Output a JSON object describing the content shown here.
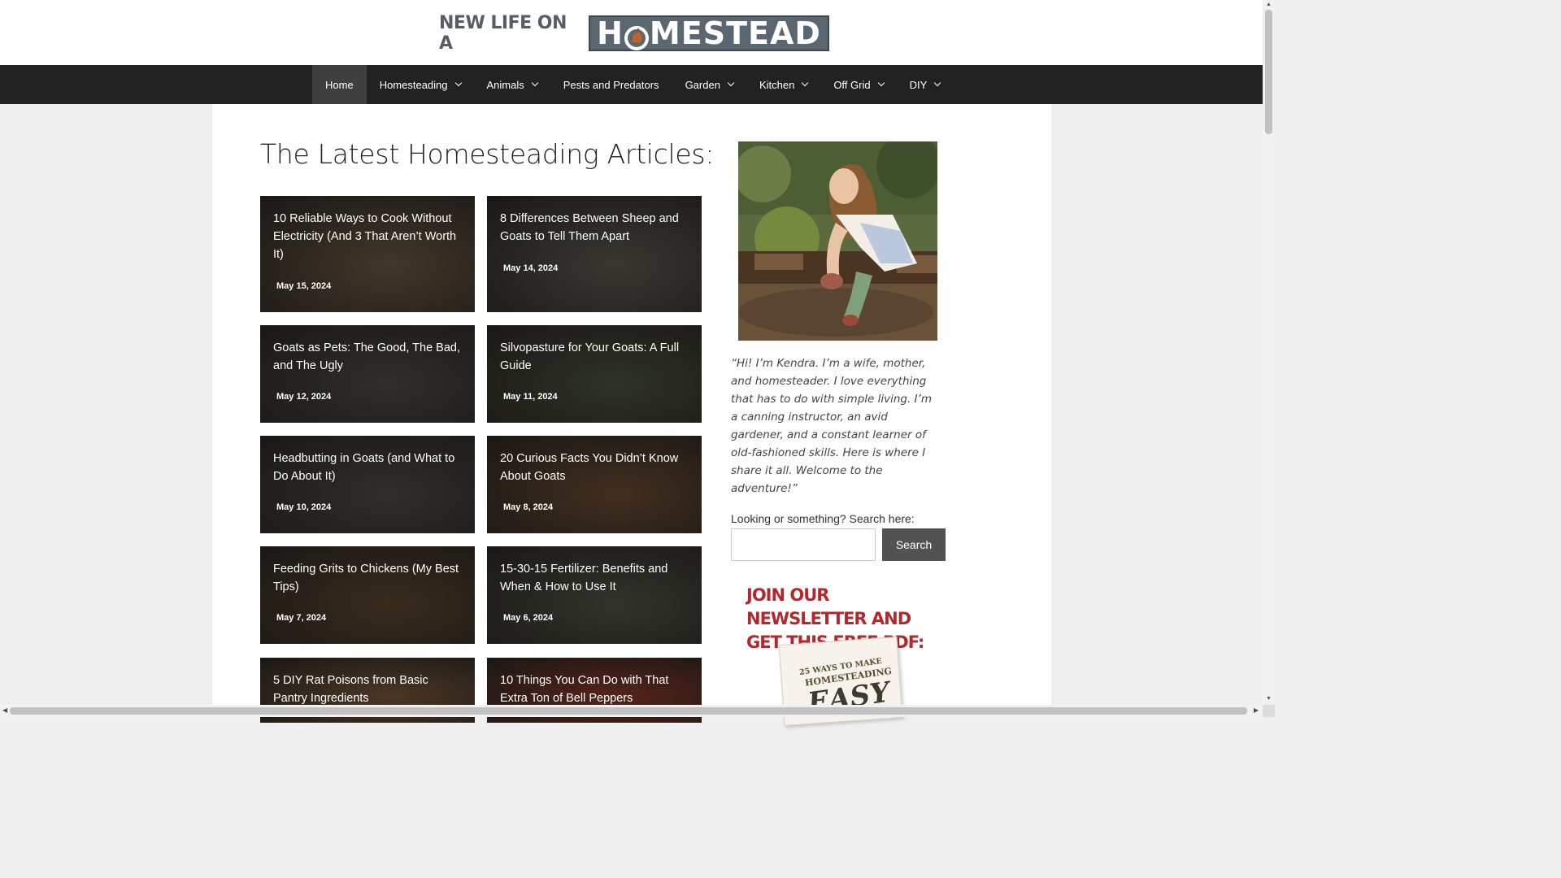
{
  "logo": {
    "prefix": "NEW LIFE ON A",
    "word_start": "H",
    "word_end": "MESTEAD"
  },
  "nav": {
    "items": [
      {
        "label": "Home",
        "active": true,
        "dropdown": false
      },
      {
        "label": "Homesteading",
        "active": false,
        "dropdown": true
      },
      {
        "label": "Animals",
        "active": false,
        "dropdown": true
      },
      {
        "label": "Pests and Predators",
        "active": false,
        "dropdown": false
      },
      {
        "label": "Garden",
        "active": false,
        "dropdown": true
      },
      {
        "label": "Kitchen",
        "active": false,
        "dropdown": true
      },
      {
        "label": "Off Grid",
        "active": false,
        "dropdown": true
      },
      {
        "label": "DIY",
        "active": false,
        "dropdown": true
      }
    ]
  },
  "main": {
    "title": "The Latest Homesteading Articles:",
    "articles": [
      {
        "title": "10 Reliable Ways to Cook Without Electricity (And 3 That Aren’t Worth It)",
        "date": "May 15, 2024",
        "image": "wood-stove",
        "color": "#6b5a44"
      },
      {
        "title": "8 Differences Between Sheep and Goats to Tell Them Apart",
        "date": "May 14, 2024",
        "image": "sheep-goat",
        "color": "#5d5a52"
      },
      {
        "title": "Goats as Pets: The Good, The Bad, and The Ugly",
        "date": "May 12, 2024",
        "image": "goat-face",
        "color": "#4e4a45"
      },
      {
        "title": "Silvopasture for Your Goats: A Full Guide",
        "date": "May 11, 2024",
        "image": "goat-woods",
        "color": "#4c5240"
      },
      {
        "title": "Headbutting in Goats (and What to Do About It)",
        "date": "May 10, 2024",
        "image": "goat-face",
        "color": "#4e4a45"
      },
      {
        "title": "20 Curious Facts You Didn’t Know About Goats",
        "date": "May 8, 2024",
        "image": "goat-eating",
        "color": "#6a4c33"
      },
      {
        "title": "Feeding Grits to Chickens (My Best Tips)",
        "date": "May 7, 2024",
        "image": "chickens",
        "color": "#5c4630"
      },
      {
        "title": "15-30-15 Fertilizer: Benefits and When & How to Use It",
        "date": "May 6, 2024",
        "image": "fertilizer",
        "color": "#505448"
      },
      {
        "title": "5 DIY Rat Poisons from Basic Pantry Ingredients",
        "date": "",
        "image": "pantry",
        "color": "#7a5a3c"
      },
      {
        "title": "10 Things You Can Do with That Extra Ton of Bell Peppers",
        "date": "",
        "image": "peppers",
        "color": "#8a3a2a"
      }
    ]
  },
  "sidebar": {
    "bio": "“Hi! I’m Kendra. I’m a wife, mother, and homesteader. I love everything that has to do with simple living. I’m a canning instructor, an avid gardener, and a constant learner of old-fashioned skills. Here is where I share it all. Welcome to the adventure!”",
    "search_label": "Looking or something? Search here:",
    "search_placeholder": "",
    "search_button": "Search",
    "newsletter": "JOIN OUR NEWSLETTER AND GET THIS FREE PDF:",
    "ebook": {
      "line1": "25 WAYS TO MAKE",
      "line2": "HOMESTEADING",
      "line3": "EASY"
    }
  },
  "colors": {
    "nav_bg": "#222222",
    "nav_active": "#3f3f3f",
    "button_bg": "#525252",
    "newsletter_red": "#b3282d",
    "logo_box": "#5b6770"
  }
}
